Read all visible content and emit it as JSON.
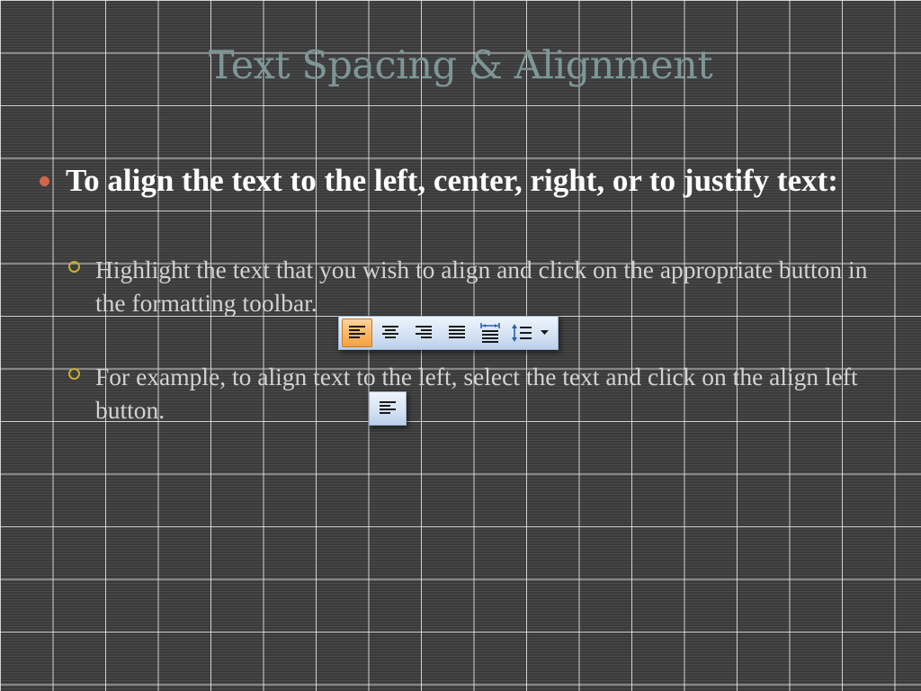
{
  "slide": {
    "title": "Text Spacing & Alignment",
    "bullet": "To align the text to the left, center, right, or to justify text:",
    "sub_bullets": [
      "Highlight the text that you wish to align and click on the appropriate button in the formatting toolbar.",
      "For example, to align text to the left, select the text and click on the align left button."
    ]
  },
  "toolbar": {
    "buttons": [
      {
        "icon": "align-left-icon",
        "active": true
      },
      {
        "icon": "align-center-icon",
        "active": false
      },
      {
        "icon": "align-right-icon",
        "active": false
      },
      {
        "icon": "justify-icon",
        "active": false
      },
      {
        "icon": "distributed-icon",
        "active": false
      },
      {
        "icon": "line-spacing-icon",
        "active": false
      }
    ],
    "dropdown_icon": "dropdown-arrow-icon"
  },
  "example_button": {
    "icon": "align-left-icon"
  },
  "colors": {
    "background": "#434343",
    "title": "#7d9796",
    "bullet_dot": "#d2664a",
    "sub_bullet_ring": "#c9ae32",
    "active_button": "#fbb45d"
  }
}
